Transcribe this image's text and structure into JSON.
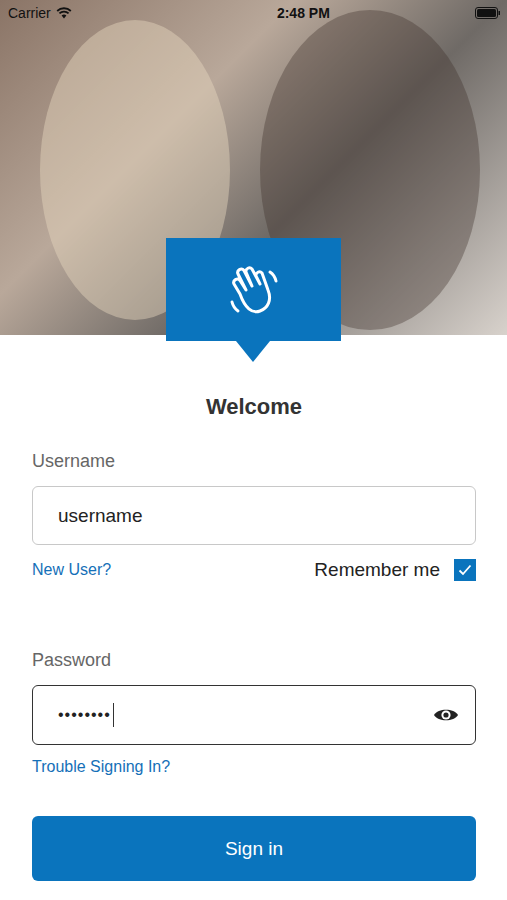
{
  "status_bar": {
    "carrier": "Carrier",
    "time": "2:48 PM"
  },
  "header": {
    "title": "Welcome"
  },
  "username": {
    "label": "Username",
    "value": "username"
  },
  "new_user_link": "New User?",
  "remember_me": {
    "label": "Remember me",
    "checked": true
  },
  "password": {
    "label": "Password",
    "masked_value": "••••••••",
    "focused": true
  },
  "trouble_link": "Trouble Signing In?",
  "sign_in_button": "Sign in"
}
